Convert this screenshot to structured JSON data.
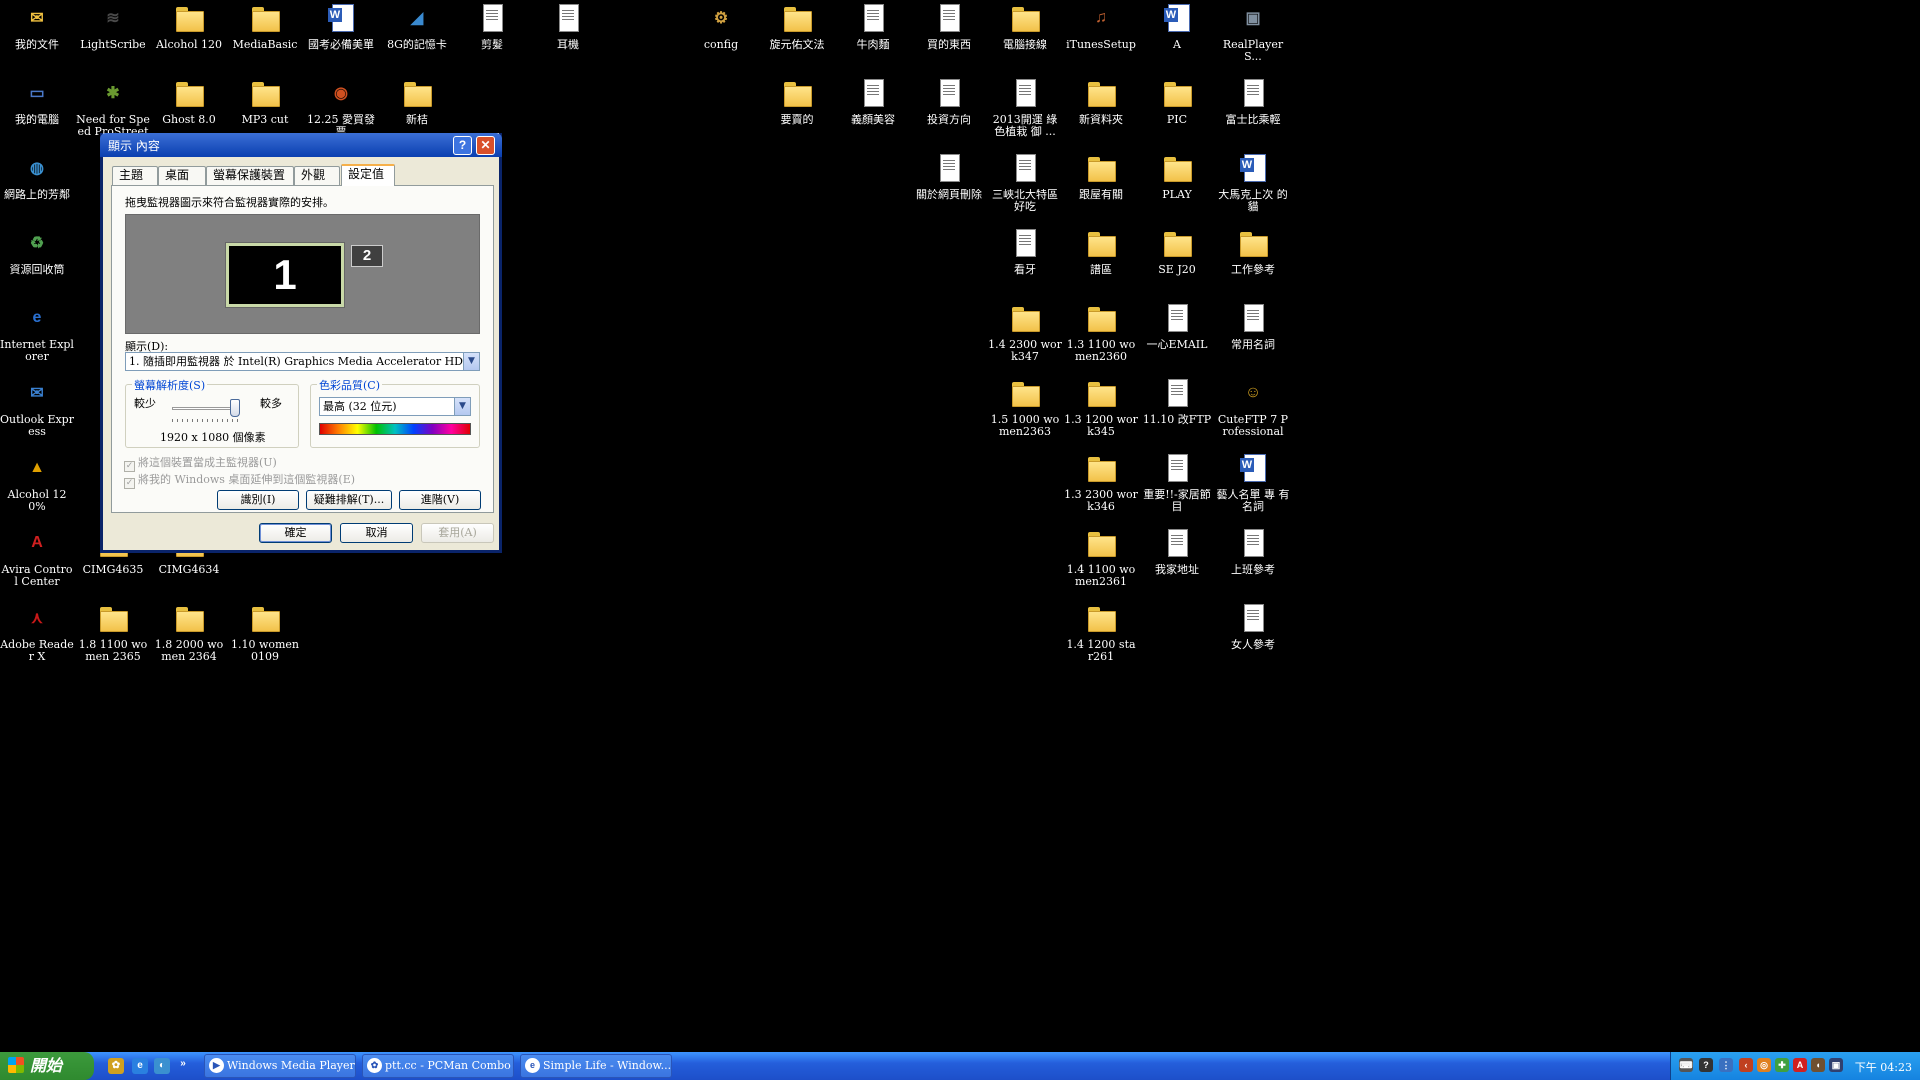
{
  "desktop": {
    "icons": [
      {
        "label": "我的文件",
        "type": "box",
        "glyph": "✉",
        "color": "#f0c040"
      },
      {
        "label": "LightScribe",
        "type": "box",
        "glyph": "≋",
        "color": "#4a4a4a"
      },
      {
        "label": "Alcohol 120",
        "type": "folder"
      },
      {
        "label": "MediaBasic",
        "type": "folder"
      },
      {
        "label": "國考必備美單",
        "type": "word"
      },
      {
        "label": "8G的記憶卡",
        "type": "box",
        "glyph": "◢",
        "color": "#3a8ad0"
      },
      {
        "label": "剪髮",
        "type": "doc"
      },
      {
        "label": "耳機",
        "type": "doc"
      },
      {
        "label": "config",
        "type": "box",
        "glyph": "⚙",
        "color": "#d0a040"
      },
      {
        "label": "旋元佑文法",
        "type": "folder"
      },
      {
        "label": "牛肉麵",
        "type": "doc"
      },
      {
        "label": "買的東西",
        "type": "doc"
      },
      {
        "label": "電腦接線",
        "type": "folder"
      },
      {
        "label": "iTunesSetup",
        "type": "box",
        "glyph": "♫",
        "color": "#c06030"
      },
      {
        "label": "A",
        "type": "word"
      },
      {
        "label": "RealPlayerS...",
        "type": "box",
        "glyph": "▣",
        "color": "#8090a0"
      },
      {
        "label": "我的電腦",
        "type": "box",
        "glyph": "▭",
        "color": "#4a78c8"
      },
      {
        "label": "Need for Speed ProStreet",
        "type": "box",
        "glyph": "✱",
        "color": "#6a9a30"
      },
      {
        "label": "Ghost 8.0",
        "type": "folder"
      },
      {
        "label": "MP3 cut",
        "type": "folder"
      },
      {
        "label": "12.25 愛買發票",
        "type": "box",
        "glyph": "◉",
        "color": "#d05020"
      },
      {
        "label": "新桔",
        "type": "folder"
      },
      {
        "label": "要賣的",
        "type": "folder"
      },
      {
        "label": "義顏美容",
        "type": "doc"
      },
      {
        "label": "投資方向",
        "type": "doc"
      },
      {
        "label": "2013開運 綠色植栽 御 ...",
        "type": "doc"
      },
      {
        "label": "新資料夾",
        "type": "folder"
      },
      {
        "label": "PIC",
        "type": "folder"
      },
      {
        "label": "富士比乘輕",
        "type": "doc"
      },
      {
        "label": "網路上的芳鄰",
        "type": "box",
        "glyph": "◍",
        "color": "#3a90d0"
      },
      {
        "label": "關於網頁刪除",
        "type": "doc"
      },
      {
        "label": "三峽北大特區 好吃",
        "type": "doc"
      },
      {
        "label": "跟屋有關",
        "type": "folder"
      },
      {
        "label": "PLAY",
        "type": "folder"
      },
      {
        "label": "大馬克上次 的貓",
        "type": "word"
      },
      {
        "label": "資源回收筒",
        "type": "box",
        "glyph": "♻",
        "color": "#50a050"
      },
      {
        "label": "看牙",
        "type": "doc"
      },
      {
        "label": "譜區",
        "type": "folder"
      },
      {
        "label": "SE J20",
        "type": "folder"
      },
      {
        "label": "工作參考",
        "type": "folder"
      },
      {
        "label": "Internet Explorer",
        "type": "box",
        "glyph": "e",
        "color": "#2a70d0"
      },
      {
        "label": "1.4 2300 work347",
        "type": "folder"
      },
      {
        "label": "1.3 1100 women2360",
        "type": "folder"
      },
      {
        "label": "一心EMAIL",
        "type": "doc"
      },
      {
        "label": "常用名詞",
        "type": "doc"
      },
      {
        "label": "Outlook Express",
        "type": "box",
        "glyph": "✉",
        "color": "#3a80d0"
      },
      {
        "label": "1.5 1000 women2363",
        "type": "folder"
      },
      {
        "label": "1.3 1200 work345",
        "type": "folder"
      },
      {
        "label": "11.10 改FTP",
        "type": "doc"
      },
      {
        "label": "CuteFTP 7 Professional",
        "type": "box",
        "glyph": "☺",
        "color": "#d0a020"
      },
      {
        "label": "Alcohol 120%",
        "type": "box",
        "glyph": "▲",
        "color": "#e0a000"
      },
      {
        "label": "1.3 2300 work346",
        "type": "folder"
      },
      {
        "label": "重要!!-家居節 目",
        "type": "doc"
      },
      {
        "label": "藝人名單 專 有名詞",
        "type": "word"
      },
      {
        "label": "Avira Control Center",
        "type": "box",
        "glyph": "A",
        "color": "#d02020"
      },
      {
        "label": "CIMG4635",
        "type": "folder"
      },
      {
        "label": "CIMG4634",
        "type": "folder"
      },
      {
        "label": "1.4 1100 women2361",
        "type": "folder"
      },
      {
        "label": "我家地址",
        "type": "doc"
      },
      {
        "label": "上班參考",
        "type": "doc"
      },
      {
        "label": "Adobe Reader X",
        "type": "box",
        "glyph": "⋏",
        "color": "#c81818"
      },
      {
        "label": "1.8 1100 women 2365",
        "type": "folder"
      },
      {
        "label": "1.8 2000 women 2364",
        "type": "folder"
      },
      {
        "label": "1.10 women0109",
        "type": "folder"
      },
      {
        "label": "1.4 1200 star261",
        "type": "folder"
      },
      {
        "label": "女人參考",
        "type": "doc"
      }
    ]
  },
  "dialog": {
    "title": "顯示 內容",
    "help_glyph": "?",
    "close_glyph": "✕",
    "tabs": [
      "主題",
      "桌面",
      "螢幕保護裝置",
      "外觀",
      "設定值"
    ],
    "active_tab": "設定值",
    "instruction": "拖曳監視器圖示來符合監視器實際的安排。",
    "monitor1": "1",
    "monitor2": "2",
    "display_label": "顯示(D):",
    "display_value": "1. 隨插即用監視器 於 Intel(R) Graphics Media Accelerator HD",
    "resolution_group": "螢幕解析度(S)",
    "less_label": "較少",
    "more_label": "較多",
    "resolution_value": "1920 x 1080 個像素",
    "resolution_slider_fraction": 1.0,
    "color_group": "色彩品質(C)",
    "color_value": "最高 (32 位元)",
    "check_primary": "將這個裝置當成主監視器(U)",
    "check_extend": "將我的 Windows 桌面延伸到這個監視器(E)",
    "identify_button": "識別(I)",
    "troubleshoot_button": "疑難排解(T)...",
    "advanced_button": "進階(V)",
    "ok_button": "確定",
    "cancel_button": "取消",
    "apply_button": "套用(A)",
    "dropdown_arrow": "▼"
  },
  "taskbar": {
    "start_label": "開始",
    "quicklaunch_more": "»",
    "windows": [
      "Windows Media Player",
      "ptt.cc - PCMan Combo",
      "Simple Life - Window..."
    ],
    "clock": "下午 04:23"
  },
  "colors": {
    "desktop_bg": "#000000",
    "taskbar_blue": "#245edb",
    "start_green": "#3c9a3c",
    "title_blue": "#0a3fb0"
  }
}
